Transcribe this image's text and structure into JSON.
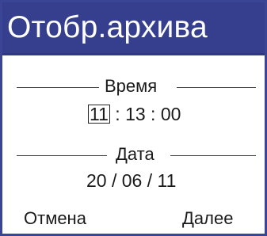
{
  "title": "Отобр.архива",
  "time": {
    "label": "Время",
    "hours": "11",
    "separator": ":",
    "minutes": "13",
    "seconds": "00"
  },
  "date": {
    "label": "Дата",
    "value": "20 / 06 / 11"
  },
  "softkeys": {
    "left": "Отмена",
    "right": "Далее"
  },
  "colors": {
    "title_background": "#353f8e",
    "title_text": "#ffffff",
    "border": "#3b4595"
  }
}
